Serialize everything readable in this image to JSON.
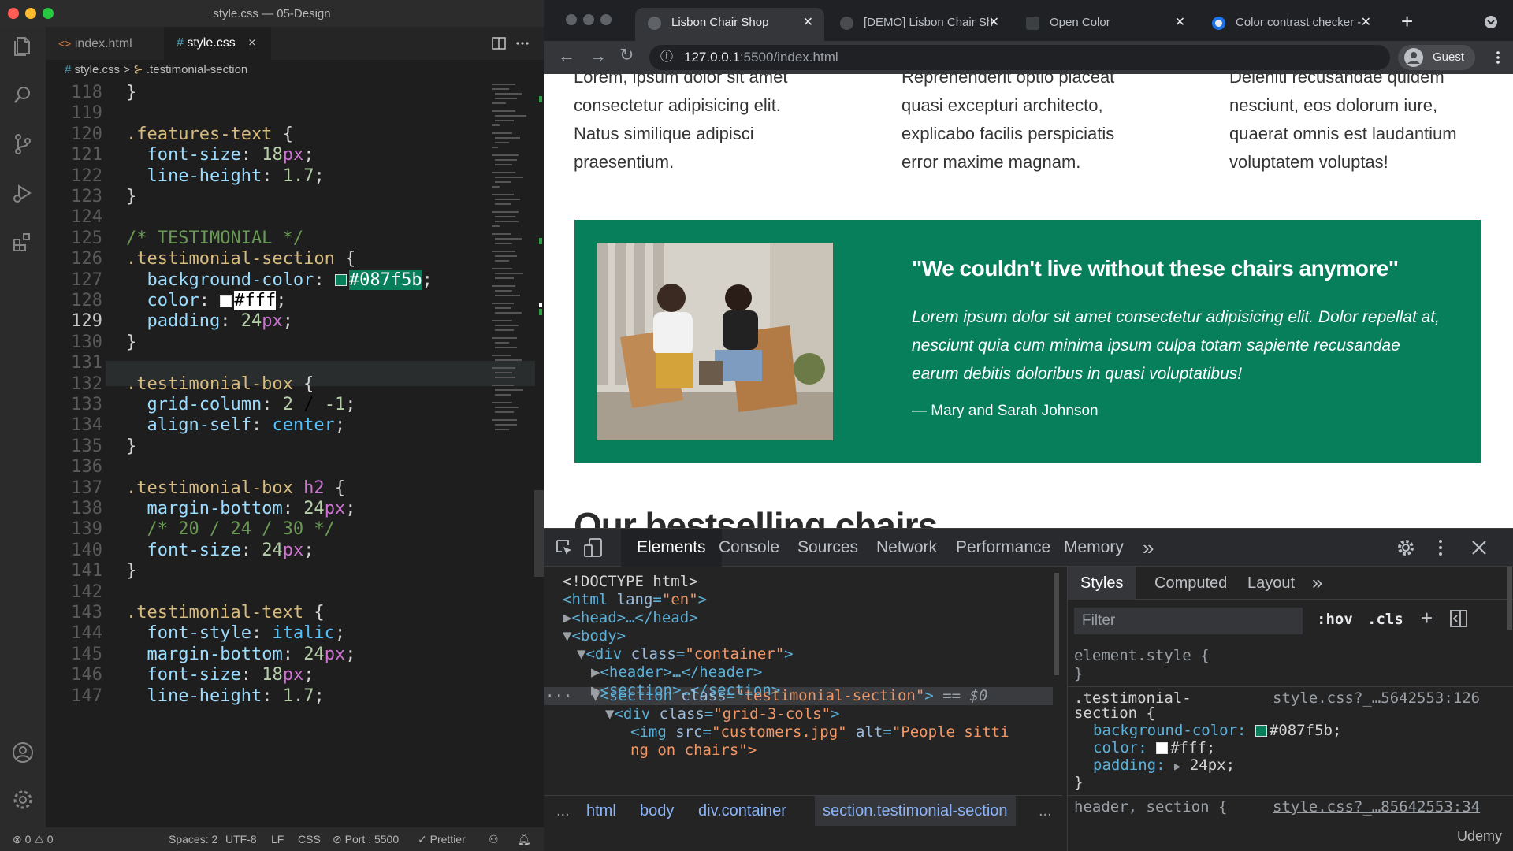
{
  "vscode": {
    "window_title": "style.css — 05-Design",
    "tabs": [
      {
        "label": "index.html",
        "icon": "html-icon"
      },
      {
        "label": "style.css",
        "icon": "css-icon",
        "close": "×"
      }
    ],
    "breadcrumb": {
      "file": "style.css",
      "separator": ">",
      "symbol": ".testimonial-section"
    },
    "code_lines": [
      {
        "n": "118",
        "t": "}"
      },
      {
        "n": "119",
        "t": ""
      },
      {
        "n": "120",
        "t": ".features-text {"
      },
      {
        "n": "121",
        "t": "  font-size: 18px;"
      },
      {
        "n": "122",
        "t": "  line-height: 1.7;"
      },
      {
        "n": "123",
        "t": "}"
      },
      {
        "n": "124",
        "t": ""
      },
      {
        "n": "125",
        "t": "/* TESTIMONIAL */"
      },
      {
        "n": "126",
        "t": ".testimonial-section {"
      },
      {
        "n": "127",
        "t": "  background-color: #087f5b;"
      },
      {
        "n": "128",
        "t": "  color: #fff;"
      },
      {
        "n": "129",
        "t": "  padding: 24px;"
      },
      {
        "n": "130",
        "t": "}"
      },
      {
        "n": "131",
        "t": ""
      },
      {
        "n": "132",
        "t": ".testimonial-box {"
      },
      {
        "n": "133",
        "t": "  grid-column: 2 / -1;"
      },
      {
        "n": "134",
        "t": "  align-self: center;"
      },
      {
        "n": "135",
        "t": "}"
      },
      {
        "n": "136",
        "t": ""
      },
      {
        "n": "137",
        "t": ".testimonial-box h2 {"
      },
      {
        "n": "138",
        "t": "  margin-bottom: 24px;"
      },
      {
        "n": "139",
        "t": "  /* 20 / 24 / 30 */"
      },
      {
        "n": "140",
        "t": "  font-size: 24px;"
      },
      {
        "n": "141",
        "t": "}"
      },
      {
        "n": "142",
        "t": ""
      },
      {
        "n": "143",
        "t": ".testimonial-text {"
      },
      {
        "n": "144",
        "t": "  font-style: italic;"
      },
      {
        "n": "145",
        "t": "  margin-bottom: 24px;"
      },
      {
        "n": "146",
        "t": "  font-size: 18px;"
      },
      {
        "n": "147",
        "t": "  line-height: 1.7;"
      }
    ],
    "current_line": "129",
    "status": {
      "errors": "0",
      "warnings": "0",
      "spaces": "Spaces: 2",
      "encoding": "UTF-8",
      "eol": "LF",
      "language": "CSS",
      "port": "Port : 5500",
      "prettier": "Prettier"
    }
  },
  "browser": {
    "tabs": [
      {
        "label": "Lisbon Chair Shop",
        "active": true
      },
      {
        "label": "[DEMO] Lisbon Chair Sh",
        "active": false
      },
      {
        "label": "Open Color",
        "active": false
      },
      {
        "label": "Color contrast checker -",
        "active": false
      }
    ],
    "new_tab": "+",
    "url": "127.0.0.1:5500/index.html",
    "url_host": "127.0.0.1",
    "url_path": ":5500/index.html",
    "profile": "Guest",
    "page": {
      "feature_columns": [
        [
          "Lorem, ipsum dolor sit amet",
          "consectetur adipisicing elit.",
          "Natus similique adipisci",
          "praesentium."
        ],
        [
          "Reprehenderit optio placeat",
          "quasi excepturi architecto,",
          "explicabo facilis perspiciatis",
          "error maxime magnam."
        ],
        [
          "Deleniti recusandae quidem",
          "nesciunt, eos dolorum iure,",
          "quaerat omnis est laudantium",
          "voluptatem voluptas!"
        ]
      ],
      "testimonial": {
        "bg_color": "#087f5b",
        "quote": "\"We couldn't live without these chairs anymore\"",
        "text": "Lorem ipsum dolor sit amet consectetur adipisicing elit. Dolor repellat at, nesciunt quia cum minima ipsum culpa totam sapiente recusandae earum debitis doloribus in quasi voluptatibus!",
        "author": "— Mary and Sarah Johnson"
      },
      "next_heading": "Our bestselling chairs"
    },
    "devtools": {
      "tabs": [
        "Elements",
        "Console",
        "Sources",
        "Network",
        "Performance",
        "Memory"
      ],
      "more": "»",
      "dom": {
        "doctype": "<!DOCTYPE html>",
        "html_tag": "<html",
        "html_attr": "lang",
        "html_val": "\"en\"",
        "head": "<head>…</head>",
        "body": "<body>",
        "div_open": "<div",
        "div_class_attr": "class",
        "div_class_val": "\"container\"",
        "header": "<header>…</header>",
        "section": "<section>…</section>",
        "sel_section_open": "<section",
        "sel_class_attr": "class",
        "sel_class_val": "\"testimonial-section\"",
        "sel_suffix": "== $0",
        "grid_div_open": "<div",
        "grid_class_attr": "class",
        "grid_class_val": "\"grid-3-cols\"",
        "img_open": "<img",
        "img_src_attr": "src",
        "img_src_val": "\"customers.jpg\"",
        "img_alt_attr": "alt",
        "img_alt_val": "\"People sitti",
        "img_alt_val2": "ng on chairs\">"
      },
      "crumbs": [
        "...",
        "html",
        "body",
        "div.container",
        "section.testimonial-section",
        "..."
      ],
      "styles_tabs": [
        "Styles",
        "Computed",
        "Layout"
      ],
      "filter_placeholder": "Filter",
      "hov": ":hov",
      "cls": ".cls",
      "rules": {
        "element_style": "element.style {",
        "close_brace": "}",
        "sel1": ".testimonial-",
        "sel2": "section {",
        "link1": "style.css?_…5642553:126",
        "p1": "background-color:",
        "v1": "#087f5b;",
        "p2": "color:",
        "v2": "#fff;",
        "p3": "padding:",
        "v3": "24px;",
        "header_sel": "header, section {",
        "link2": "style.css?_…85642553:34"
      }
    }
  },
  "watermark": "Udemy"
}
